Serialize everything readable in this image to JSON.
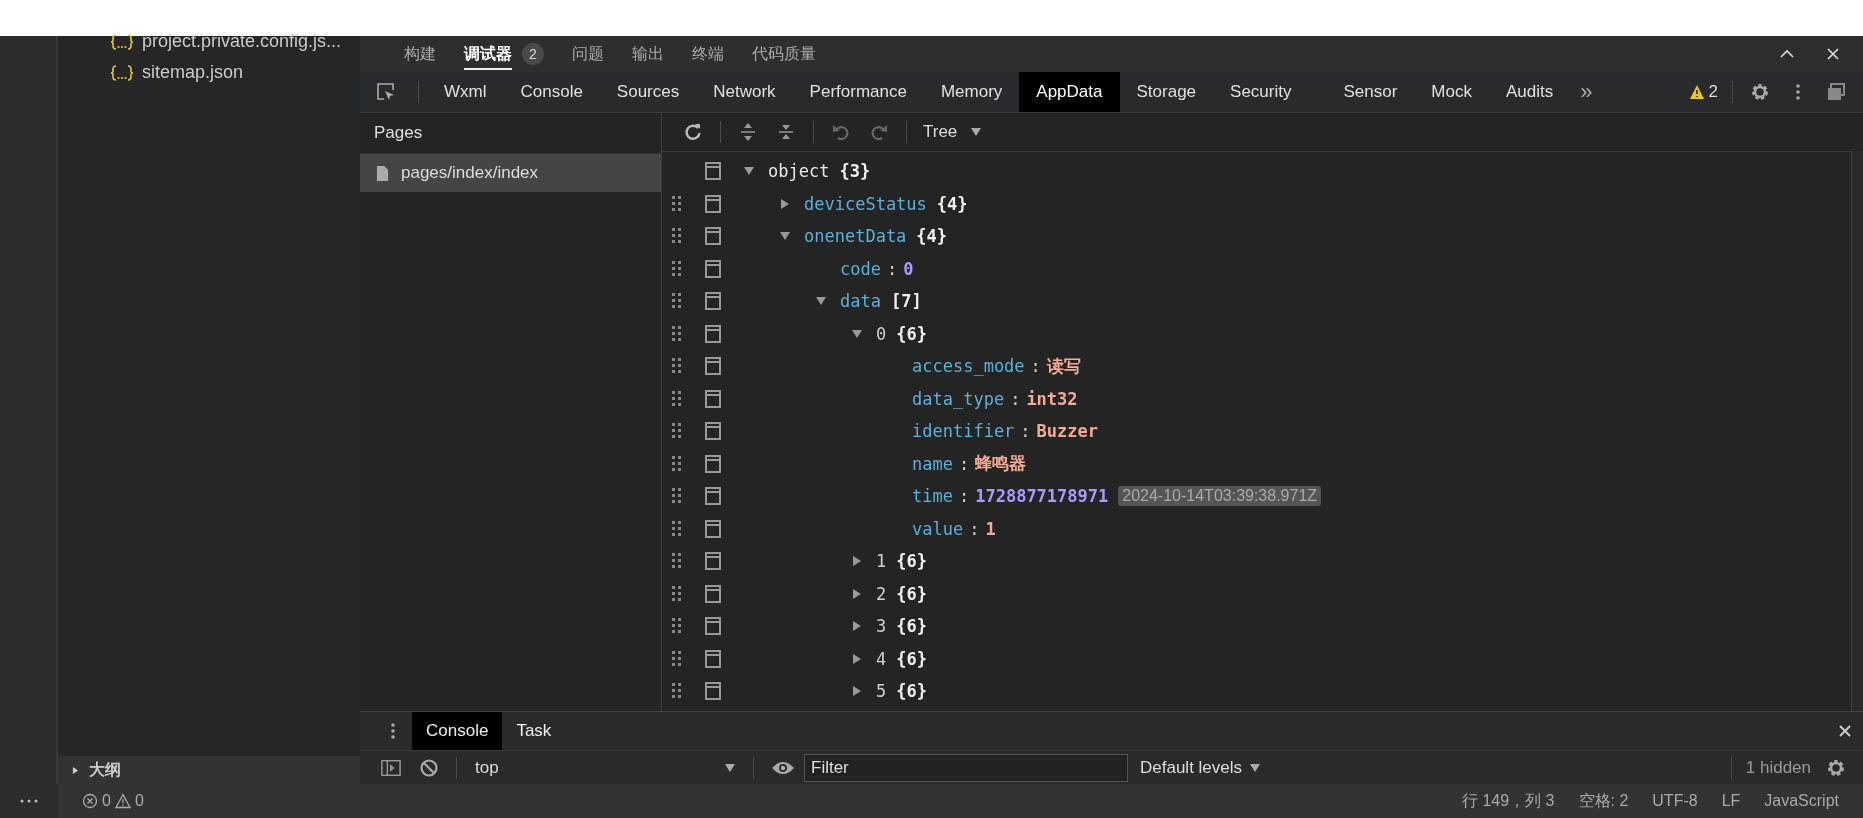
{
  "explorer": {
    "files": [
      {
        "name": "project.private.config.js..."
      },
      {
        "name": "sitemap.json"
      }
    ],
    "outline": {
      "label": "大纲",
      "expanded": false
    }
  },
  "panel_tabs": [
    {
      "label": "构建",
      "selected": false
    },
    {
      "label": "调试器",
      "selected": true,
      "badge": "2"
    },
    {
      "label": "问题",
      "selected": false
    },
    {
      "label": "输出",
      "selected": false
    },
    {
      "label": "终端",
      "selected": false
    },
    {
      "label": "代码质量",
      "selected": false
    }
  ],
  "devtools_tabs": [
    {
      "label": "Wxml",
      "selected": false
    },
    {
      "label": "Console",
      "selected": false
    },
    {
      "label": "Sources",
      "selected": false
    },
    {
      "label": "Network",
      "selected": false
    },
    {
      "label": "Performance",
      "selected": false
    },
    {
      "label": "Memory",
      "selected": false
    },
    {
      "label": "AppData",
      "selected": true
    },
    {
      "label": "Storage",
      "selected": false
    },
    {
      "label": "Security",
      "selected": false
    },
    {
      "label": "Sensor",
      "selected": false
    },
    {
      "label": "Mock",
      "selected": false
    },
    {
      "label": "Audits",
      "selected": false
    }
  ],
  "overflow": "»",
  "warning_count": "2",
  "pages": {
    "title": "Pages",
    "items": [
      {
        "label": "pages/index/index",
        "selected": true
      }
    ]
  },
  "toolbar": {
    "view": "Tree"
  },
  "tree": [
    {
      "kind": "root",
      "key": "object",
      "summary": "{3}",
      "expanded": true,
      "children": [
        {
          "kind": "property",
          "key": "deviceStatus",
          "summary": "{4}",
          "expanded": false
        },
        {
          "kind": "property",
          "key": "onenetData",
          "summary": "{4}",
          "expanded": true,
          "children": [
            {
              "kind": "property",
              "key": "code",
              "sep": ":",
              "value": "0",
              "numeric": true
            },
            {
              "kind": "property",
              "key": "data",
              "summary": "[7]",
              "expanded": true,
              "children": [
                {
                  "kind": "index",
                  "key": "0",
                  "summary": "{6}",
                  "expanded": true,
                  "children": [
                    {
                      "kind": "property",
                      "key": "access_mode",
                      "sep": ":",
                      "value": "读写",
                      "numeric": false
                    },
                    {
                      "kind": "property",
                      "key": "data_type",
                      "sep": ":",
                      "value": "int32",
                      "numeric": false
                    },
                    {
                      "kind": "property",
                      "key": "identifier",
                      "sep": ":",
                      "value": "Buzzer",
                      "numeric": false
                    },
                    {
                      "kind": "property",
                      "key": "name",
                      "sep": ":",
                      "value": "蜂鸣器",
                      "numeric": false
                    },
                    {
                      "kind": "property",
                      "key": "time",
                      "sep": ":",
                      "value": "1728877178971",
                      "numeric": true,
                      "note": "2024-10-14T03:39:38.971Z"
                    },
                    {
                      "kind": "property",
                      "key": "value",
                      "sep": ":",
                      "value": "1",
                      "numeric": false
                    }
                  ]
                },
                {
                  "kind": "index",
                  "key": "1",
                  "summary": "{6}",
                  "expanded": false
                },
                {
                  "kind": "index",
                  "key": "2",
                  "summary": "{6}",
                  "expanded": false
                },
                {
                  "kind": "index",
                  "key": "3",
                  "summary": "{6}",
                  "expanded": false
                },
                {
                  "kind": "index",
                  "key": "4",
                  "summary": "{6}",
                  "expanded": false
                },
                {
                  "kind": "index",
                  "key": "5",
                  "summary": "{6}",
                  "expanded": false
                }
              ]
            }
          ]
        }
      ]
    }
  ],
  "console_drawer": {
    "tabs": [
      {
        "label": "Console",
        "selected": true
      },
      {
        "label": "Task",
        "selected": false
      }
    ],
    "context": "top",
    "filter_placeholder": "Filter",
    "levels": "Default levels",
    "hidden": "1 hidden"
  },
  "status_bar": {
    "errors": "0",
    "warnings": "0",
    "items": [
      "行 149，列 3",
      "空格: 2",
      "UTF-8",
      "LF",
      "JavaScript"
    ]
  }
}
